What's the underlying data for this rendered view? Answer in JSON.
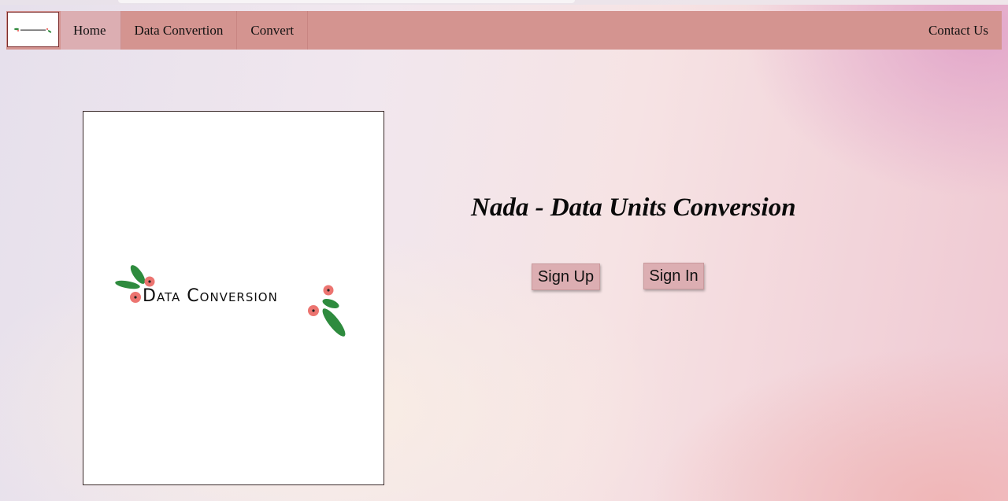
{
  "navbar": {
    "items": [
      {
        "label": "Home",
        "active": true
      },
      {
        "label": "Data Convertion"
      },
      {
        "label": "Convert"
      }
    ],
    "contact_label": "Contact Us"
  },
  "hero": {
    "logo_text": "Data Conversion",
    "accent_colors": {
      "leaf": "#2e8b3e",
      "flower": "#ec7470"
    }
  },
  "main": {
    "headline": "Nada - Data Units Conversion",
    "signup_label": "Sign Up",
    "signin_label": "Sign In"
  },
  "colors": {
    "navbar": "#d49490",
    "active_nav": "#dcaeb2",
    "button": "#dcaeb2"
  }
}
